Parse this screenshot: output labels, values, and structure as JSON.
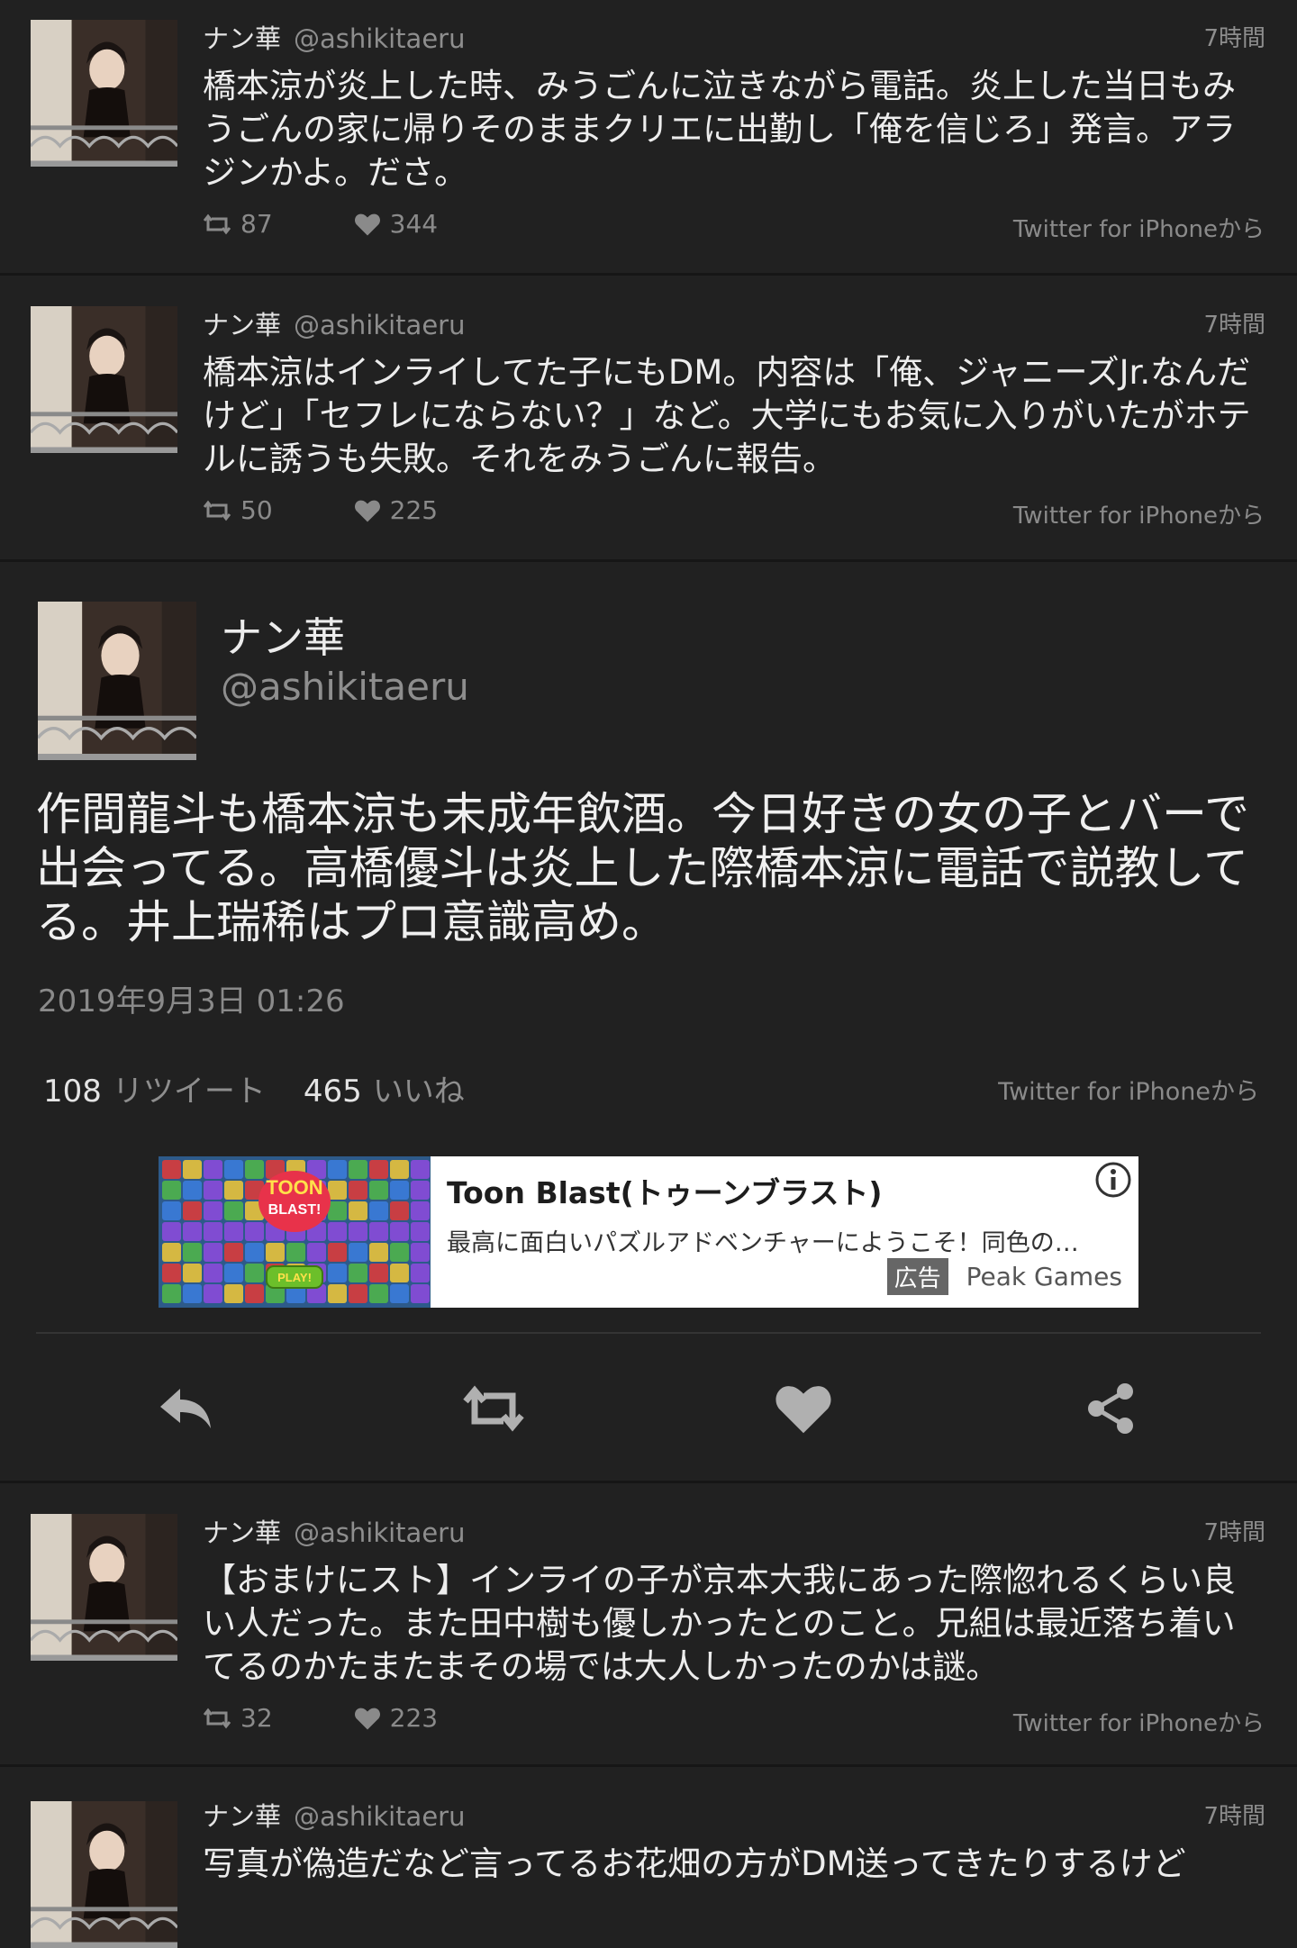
{
  "tweets_above": [
    {
      "name": "ナン華",
      "handle": "@ashikitaeru",
      "time": "7時間",
      "text": "橋本涼が炎上した時、みうごんに泣きながら電話。炎上した当日もみうごんの家に帰りそのままクリエに出勤し「俺を信じろ」発言。アラジンかよ。ださ。",
      "retweets": "87",
      "likes": "344",
      "source": "Twitter for iPhoneから"
    },
    {
      "name": "ナン華",
      "handle": "@ashikitaeru",
      "time": "7時間",
      "text": "橋本涼はインライしてた子にもDM。内容は「俺、ジャニーズJr.なんだけど」「セフレにならない？」など。大学にもお気に入りがいたがホテルに誘うも失敗。それをみうごんに報告。",
      "retweets": "50",
      "likes": "225",
      "source": "Twitter for iPhoneから"
    }
  ],
  "main_tweet": {
    "name": "ナン華",
    "handle": "@ashikitaeru",
    "text": "作間龍斗も橋本涼も未成年飲酒。今日好きの女の子とバーで出会ってる。高橋優斗は炎上した際橋本涼に電話で説教してる。井上瑞稀はプロ意識高め。",
    "date": "2019年9月3日 01:26",
    "retweet_count": "108",
    "retweet_label": "リツイート",
    "like_count": "465",
    "like_label": "いいね",
    "source": "Twitter for iPhoneから"
  },
  "ad": {
    "title": "Toon Blast(トゥーンブラスト)",
    "description": "最高に面白いパズルアドベンチャーにようこそ！同色の…",
    "badge": "広告",
    "advertiser": "Peak Games",
    "logo_line1": "TOON",
    "logo_line2": "BLAST!",
    "play_label": "PLAY!"
  },
  "actions": [
    "reply-icon",
    "retweet-icon",
    "heart-icon",
    "share-icon"
  ],
  "tweets_below": [
    {
      "name": "ナン華",
      "handle": "@ashikitaeru",
      "time": "7時間",
      "text": "【おまけにスト】インライの子が京本大我にあった際惚れるくらい良い人だった。また田中樹も優しかったとのこと。兄組は最近落ち着いてるのかたまたまその場では大人しかったのかは謎。",
      "retweets": "32",
      "likes": "223",
      "source": "Twitter for iPhoneから"
    },
    {
      "name": "ナン華",
      "handle": "@ashikitaeru",
      "time": "7時間",
      "text": "写真が偽造だなど言ってるお花畑の方がDM送ってきたりするけど"
    }
  ],
  "colors": {
    "background": "#212121",
    "separator": "#161616",
    "text_primary": "#ededed",
    "text_secondary": "#8e8e8e",
    "icon": "#b0b0b0"
  }
}
